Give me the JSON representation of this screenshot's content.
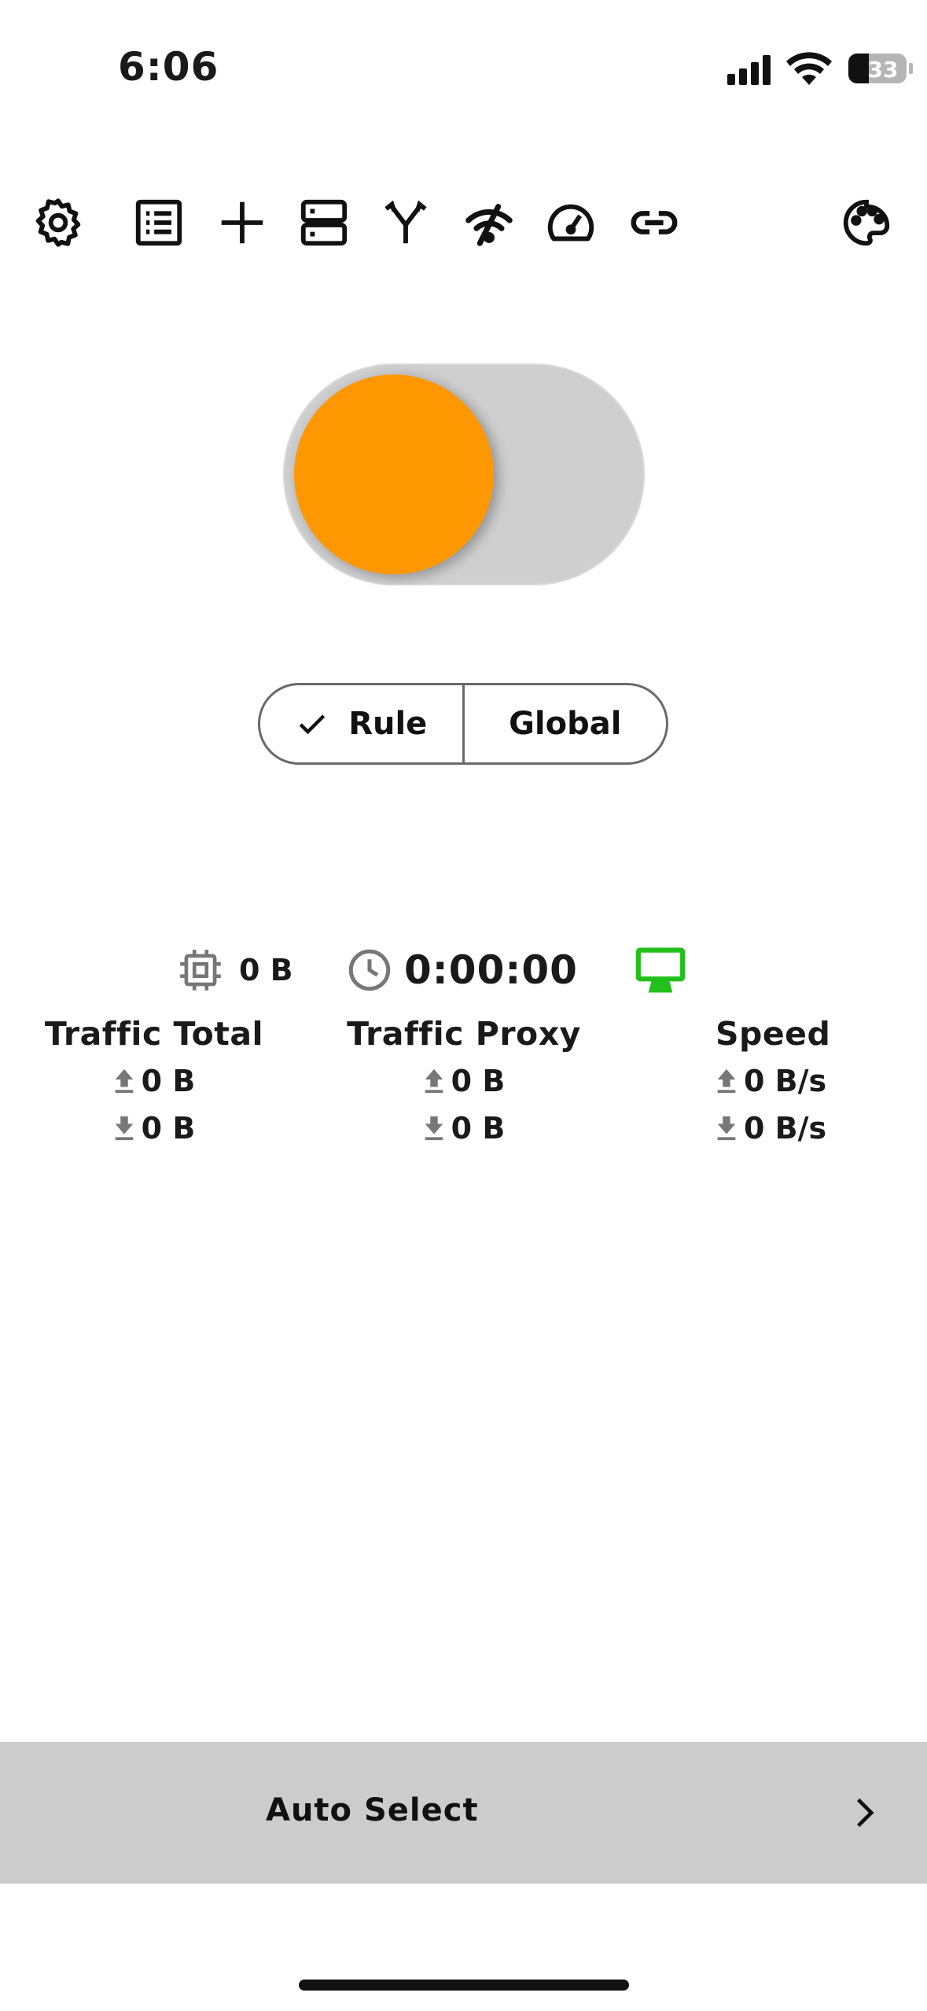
{
  "status_bar": {
    "time": "6:06",
    "battery": "33"
  },
  "toolbar": {
    "icons": [
      "gear-icon",
      "list-icon",
      "plus-icon",
      "server-icon",
      "fork-icon",
      "signal-slash-icon",
      "speedometer-icon",
      "link-icon",
      "palette-icon"
    ]
  },
  "toggle": {
    "state": "off",
    "knob_color": "#FF9800",
    "track_color": "#CFCFCF"
  },
  "mode": {
    "options": [
      "Rule",
      "Global"
    ],
    "selected": "Rule"
  },
  "stats": {
    "memory": "0 B",
    "duration": "0:00:00",
    "traffic_total": {
      "title": "Traffic Total",
      "up": "0 B",
      "down": "0 B"
    },
    "traffic_proxy": {
      "title": "Traffic Proxy",
      "up": "0 B",
      "down": "0 B"
    },
    "speed": {
      "title": "Speed",
      "up": "0 B/s",
      "down": "0 B/s"
    }
  },
  "bottom": {
    "label": "Auto Select"
  },
  "colors": {
    "accent": "#FF9800",
    "monitor": "#22C01A",
    "gray_icon": "#777777"
  }
}
